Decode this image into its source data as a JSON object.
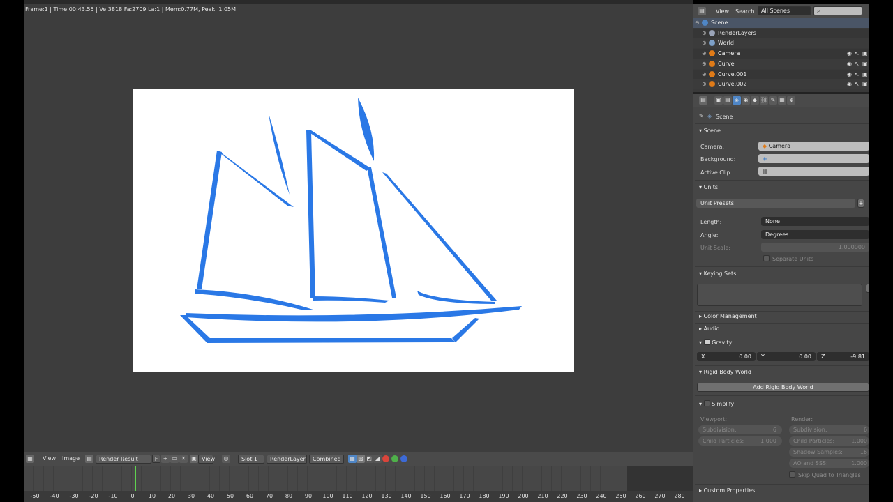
{
  "render": {
    "stats": "Frame:1 | Time:00:43.55 | Ve:3818 Fa:2709 La:1 | Mem:0.77M, Peak: 1.05M"
  },
  "image_header": {
    "view": "View",
    "image": "Image",
    "image_name": "Render Result",
    "fake_user": "F",
    "view_mode": "View",
    "slot": "Slot 1",
    "layer": "RenderLayer",
    "pass": "Combined"
  },
  "timeline": {
    "ticks": [
      "-50",
      "-40",
      "-30",
      "-20",
      "-10",
      "0",
      "10",
      "20",
      "30",
      "40",
      "50",
      "60",
      "70",
      "80",
      "90",
      "100",
      "110",
      "120",
      "130",
      "140",
      "150",
      "160",
      "170",
      "180",
      "190",
      "200",
      "210",
      "220",
      "230",
      "240",
      "250",
      "260",
      "270",
      "280"
    ]
  },
  "outliner": {
    "view": "View",
    "search": "Search",
    "scene_filter": "All Scenes",
    "items": [
      {
        "name": "Scene",
        "color": "#4f86c6"
      },
      {
        "name": "RenderLayers",
        "color": "#9aa4b8"
      },
      {
        "name": "World",
        "color": "#7da0c8"
      },
      {
        "name": "Camera",
        "color": "#e07b18"
      },
      {
        "name": "Curve",
        "color": "#e07b18"
      },
      {
        "name": "Curve.001",
        "color": "#e07b18"
      },
      {
        "name": "Curve.002",
        "color": "#e07b18"
      }
    ]
  },
  "properties": {
    "breadcrumb": "Scene",
    "scene": {
      "title": "Scene",
      "camera_label": "Camera:",
      "camera_value": "Camera",
      "background_label": "Background:",
      "active_clip_label": "Active Clip:"
    },
    "units": {
      "title": "Units",
      "presets": "Unit Presets",
      "length_label": "Length:",
      "length_value": "None",
      "angle_label": "Angle:",
      "angle_value": "Degrees",
      "scale_label": "Unit Scale:",
      "scale_value": "1.000000",
      "separate": "Separate Units"
    },
    "keying_sets": {
      "title": "Keying Sets"
    },
    "color_management": {
      "title": "Color Management"
    },
    "audio": {
      "title": "Audio"
    },
    "gravity": {
      "title": "Gravity",
      "x_label": "X:",
      "x_value": "0.00",
      "y_label": "Y:",
      "y_value": "0.00",
      "z_label": "Z:",
      "z_value": "-9.81"
    },
    "rigid_body": {
      "title": "Rigid Body World",
      "add_button": "Add Rigid Body World"
    },
    "simplify": {
      "title": "Simplify",
      "viewport_label": "Viewport:",
      "render_label": "Render:",
      "vp_subdivision_label": "Subdivision:",
      "vp_subdivision_value": "6",
      "vp_child_label": "Child Particles:",
      "vp_child_value": "1.000",
      "r_subdivision_label": "Subdivision:",
      "r_subdivision_value": "6",
      "r_child_label": "Child Particles:",
      "r_child_value": "1.000",
      "shadow_label": "Shadow Samples:",
      "shadow_value": "16",
      "ao_label": "AO and SSS:",
      "ao_value": "1.000",
      "skip_quad": "Skip Quad to Triangles"
    },
    "custom_properties": {
      "title": "Custom Properties"
    }
  },
  "colors": {
    "boat_stroke": "#2a78e6",
    "playhead": "#5fd14f"
  }
}
